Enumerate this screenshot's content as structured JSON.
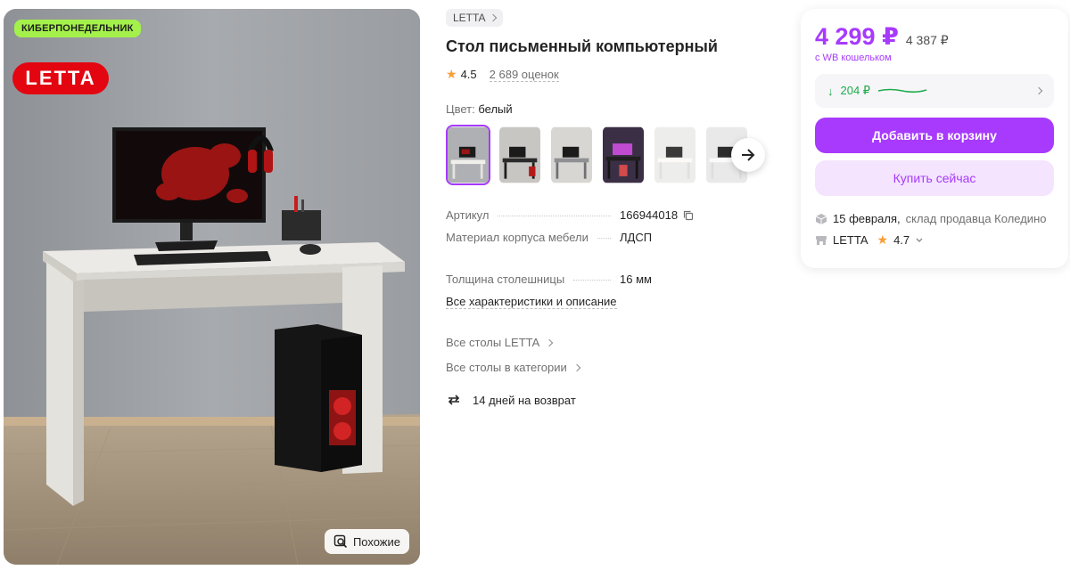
{
  "photo": {
    "promo_badge": "КИБЕРПОНЕДЕЛЬНИК",
    "brand_logo": "LETTA",
    "similar_label": "Похожие",
    "similar_icon": "search-similar-icon"
  },
  "product": {
    "brand": "LETTA",
    "title": "Стол письменный компьютерный",
    "rating": "4.5",
    "reviews": "2 689 оценок",
    "color_label": "Цвет:",
    "color_value": "белый",
    "thumbnails_count": 6,
    "specs": [
      {
        "key": "Артикул",
        "value": "166944018"
      },
      {
        "key": "Материал корпуса мебели",
        "value": "ЛДСП"
      },
      {
        "key": "Толщина столешницы",
        "value": "16 мм"
      }
    ],
    "all_specs_link": "Все характеристики и описание",
    "links": [
      "Все столы LETTA",
      "Все столы в категории"
    ],
    "return_policy": "14 дней на возврат"
  },
  "buy_card": {
    "price": "4 299 ₽",
    "old_price": "4 387 ₽",
    "wallet_note": "с WB кошельком",
    "cashback": "204 ₽",
    "add_to_cart": "Добавить в корзину",
    "buy_now": "Купить сейчас",
    "delivery_date": "15 февраля,",
    "delivery_place": "склад продавца Коледино",
    "seller_name": "LETTA",
    "seller_rating": "4.7"
  },
  "colors": {
    "accent": "#a73afd",
    "promo": "#a4f14b",
    "brand_red": "#e30611",
    "cashback_green": "#1eab4a",
    "star": "#f89d37"
  }
}
